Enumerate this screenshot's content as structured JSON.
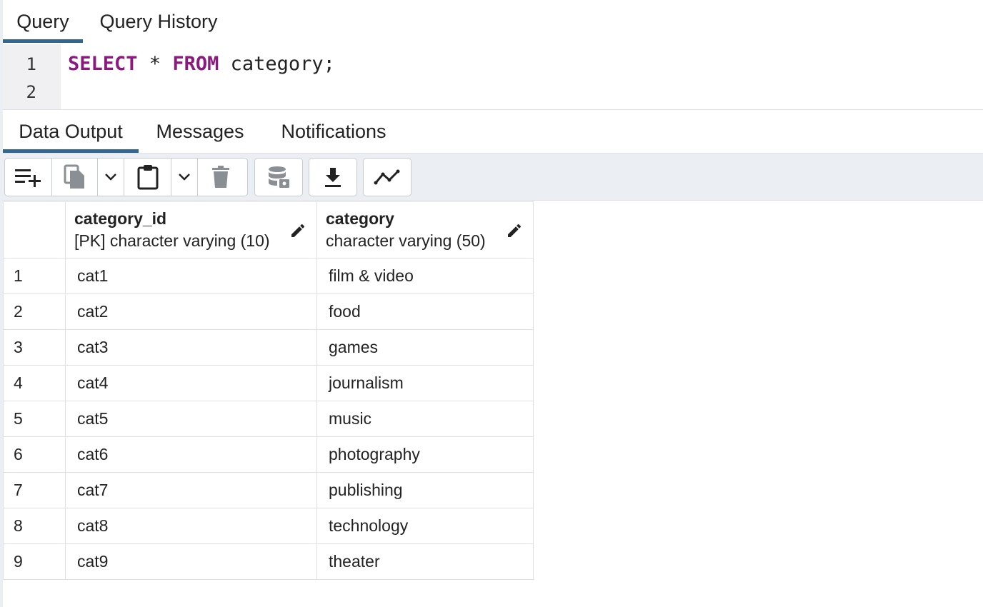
{
  "query_tabs": [
    {
      "label": "Query",
      "active": true
    },
    {
      "label": "Query History",
      "active": false
    }
  ],
  "editor": {
    "line_numbers": [
      "1",
      "2"
    ],
    "keyword_select": "SELECT",
    "star": " * ",
    "keyword_from": "FROM",
    "rest": " category;"
  },
  "output_tabs": [
    {
      "label": "Data Output",
      "active": true
    },
    {
      "label": "Messages",
      "active": false
    },
    {
      "label": "Notifications",
      "active": false
    }
  ],
  "toolbar": {
    "icons": [
      "add-row-icon",
      "copy-icon",
      "chevron-down-icon",
      "paste-icon",
      "chevron-down-icon",
      "delete-icon",
      "save-data-icon",
      "download-icon",
      "graph-icon"
    ]
  },
  "grid": {
    "columns": [
      {
        "name": "category_id",
        "type": "[PK] character varying (10)"
      },
      {
        "name": "category",
        "type": "character varying (50)"
      }
    ],
    "rows": [
      {
        "n": "1",
        "category_id": "cat1",
        "category": "film & video"
      },
      {
        "n": "2",
        "category_id": "cat2",
        "category": "food"
      },
      {
        "n": "3",
        "category_id": "cat3",
        "category": "games"
      },
      {
        "n": "4",
        "category_id": "cat4",
        "category": "journalism"
      },
      {
        "n": "5",
        "category_id": "cat5",
        "category": "music"
      },
      {
        "n": "6",
        "category_id": "cat6",
        "category": "photography"
      },
      {
        "n": "7",
        "category_id": "cat7",
        "category": "publishing"
      },
      {
        "n": "8",
        "category_id": "cat8",
        "category": "technology"
      },
      {
        "n": "9",
        "category_id": "cat9",
        "category": "theater"
      }
    ]
  },
  "colors": {
    "accent": "#326690",
    "keyword": "#8a1a7e",
    "toolbar_bg": "#ebeef3"
  }
}
